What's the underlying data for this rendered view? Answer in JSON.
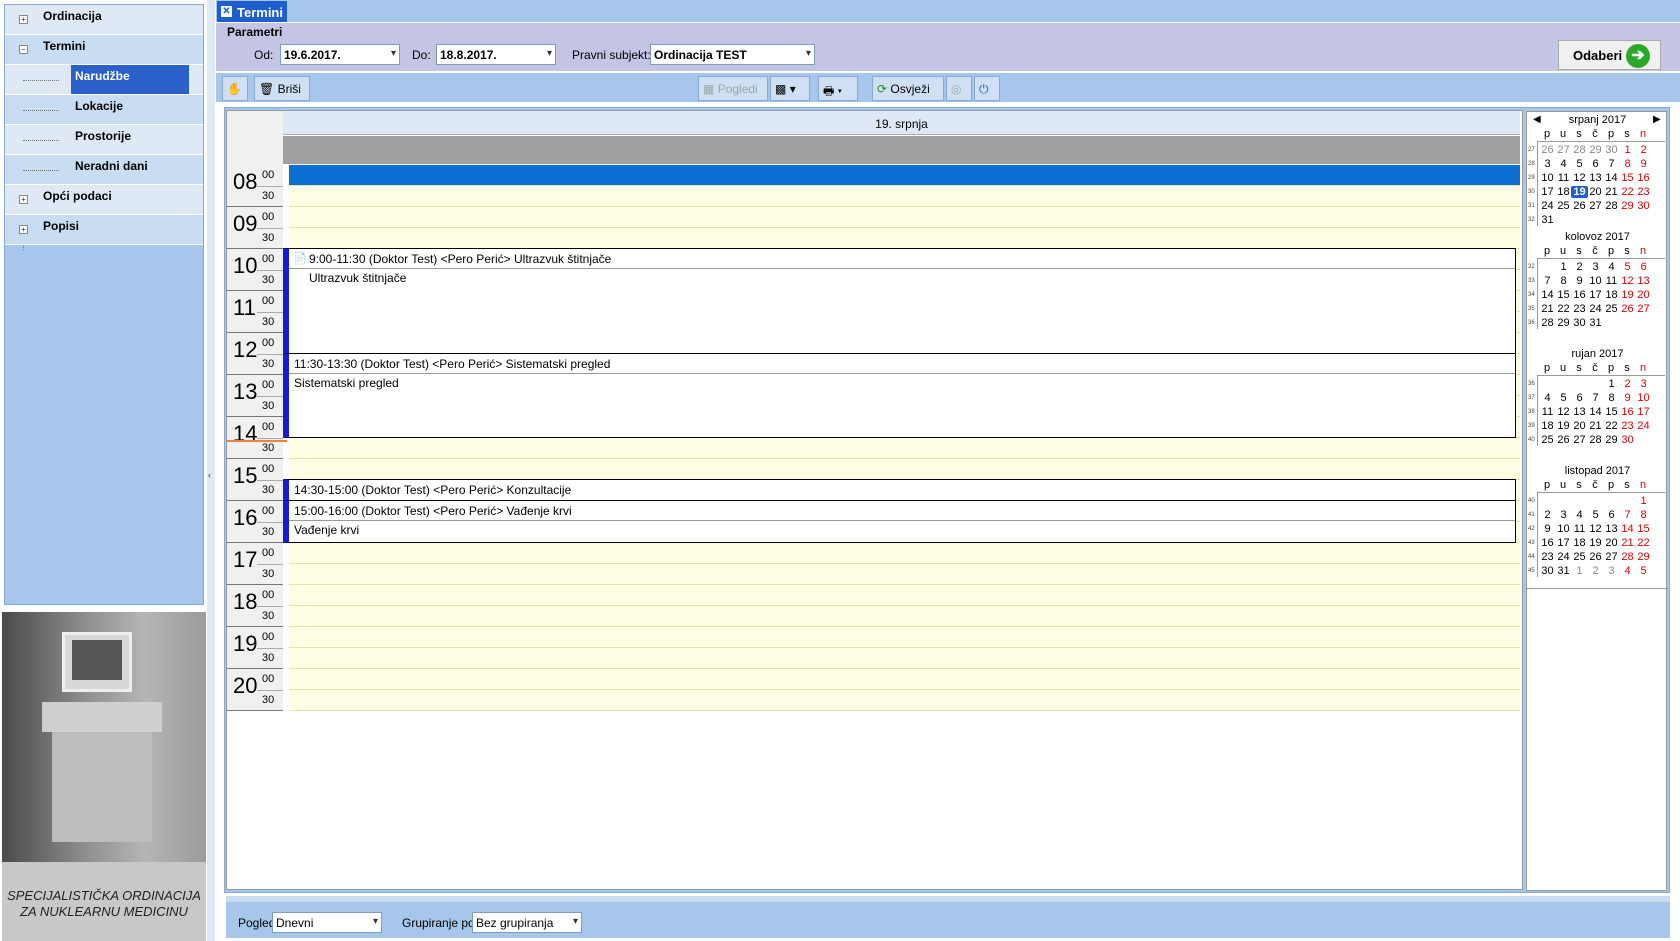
{
  "nav": {
    "items": [
      {
        "label": "Ordinacija",
        "expander": "+"
      },
      {
        "label": "Termini",
        "expander": "−"
      },
      {
        "label": "Narudžbe"
      },
      {
        "label": "Lokacije"
      },
      {
        "label": "Prostorije"
      },
      {
        "label": "Neradni dani"
      },
      {
        "label": "Opći podaci",
        "expander": "+"
      },
      {
        "label": "Popisi",
        "expander": "+"
      }
    ],
    "selected": "Narudžbe",
    "caption_line1": "SPECIJALISTIČKA ORDINACIJA",
    "caption_line2": "ZA NUKLEARNU MEDICINU"
  },
  "tab": {
    "label": "Termini"
  },
  "params": {
    "title": "Parametri",
    "od_label": "Od:",
    "od_value": "19.6.2017.",
    "do_label": "Do:",
    "do_value": "18.8.2017.",
    "subjekt_label": "Pravni subjekt:",
    "subjekt_value": "Ordinacija TEST",
    "odaberi_label": "Odaberi"
  },
  "toolbar": {
    "brisi": "Briši",
    "pogledi": "Pogledi",
    "osvjezi": "Osvježi"
  },
  "calendar": {
    "day_header": "19. srpnja",
    "hours": [
      "08",
      "09",
      "10",
      "11",
      "12",
      "13",
      "14",
      "15",
      "16",
      "17",
      "18",
      "19",
      "20"
    ],
    "m00": "00",
    "m30": "30",
    "appointments": [
      {
        "title": "9:00-11:30  (Doktor Test) <Pero Perić> Ultrazvuk štitnjače",
        "desc": "Ultrazvuk štitnjače",
        "start": 9.0,
        "end": 11.5,
        "has_icon": true
      },
      {
        "title": "11:30-13:30  (Doktor Test) <Pero Perić> Sistematski pregled",
        "desc": "Sistematski pregled",
        "start": 11.5,
        "end": 13.5,
        "has_icon": false
      },
      {
        "title": "14:30-15:00  (Doktor Test) <Pero Perić> Konzultacije",
        "desc": "",
        "start": 14.5,
        "end": 15.0,
        "has_icon": false
      },
      {
        "title": "15:00-16:00  (Doktor Test) <Pero Perić> Vađenje krvi",
        "desc": "Vađenje krvi",
        "start": 15.0,
        "end": 16.0,
        "has_icon": false
      }
    ]
  },
  "minical": {
    "weekdays": [
      "p",
      "u",
      "s",
      "č",
      "p",
      "s",
      "n"
    ],
    "months": [
      {
        "title": "srpanj 2017",
        "weeks": [
          {
            "wn": "27",
            "days": [
              [
                "26",
                "g"
              ],
              [
                "27",
                "g"
              ],
              [
                "28",
                "g"
              ],
              [
                "29",
                "g"
              ],
              [
                "30",
                "g"
              ],
              [
                "1",
                "r"
              ],
              [
                "2",
                "r"
              ]
            ]
          },
          {
            "wn": "28",
            "days": [
              [
                "3",
                ""
              ],
              [
                "4",
                ""
              ],
              [
                "5",
                ""
              ],
              [
                "6",
                ""
              ],
              [
                "7",
                ""
              ],
              [
                "8",
                "r"
              ],
              [
                "9",
                "r"
              ]
            ]
          },
          {
            "wn": "29",
            "days": [
              [
                "10",
                ""
              ],
              [
                "11",
                ""
              ],
              [
                "12",
                ""
              ],
              [
                "13",
                ""
              ],
              [
                "14",
                ""
              ],
              [
                "15",
                "r"
              ],
              [
                "16",
                "r"
              ]
            ]
          },
          {
            "wn": "30",
            "days": [
              [
                "17",
                ""
              ],
              [
                "18",
                ""
              ],
              [
                "19",
                "t"
              ],
              [
                "20",
                ""
              ],
              [
                "21",
                ""
              ],
              [
                "22",
                "r"
              ],
              [
                "23",
                "r"
              ]
            ]
          },
          {
            "wn": "31",
            "days": [
              [
                "24",
                ""
              ],
              [
                "25",
                ""
              ],
              [
                "26",
                ""
              ],
              [
                "27",
                ""
              ],
              [
                "28",
                ""
              ],
              [
                "29",
                "r"
              ],
              [
                "30",
                "r"
              ]
            ]
          },
          {
            "wn": "32",
            "days": [
              [
                "31",
                ""
              ]
            ]
          }
        ]
      },
      {
        "title": "kolovoz 2017",
        "weeks": [
          {
            "wn": "32",
            "days": [
              [
                "",
                ""
              ],
              [
                "1",
                ""
              ],
              [
                "2",
                ""
              ],
              [
                "3",
                ""
              ],
              [
                "4",
                ""
              ],
              [
                "5",
                "r"
              ],
              [
                "6",
                "r"
              ]
            ]
          },
          {
            "wn": "33",
            "days": [
              [
                "7",
                ""
              ],
              [
                "8",
                ""
              ],
              [
                "9",
                ""
              ],
              [
                "10",
                ""
              ],
              [
                "11",
                ""
              ],
              [
                "12",
                "r"
              ],
              [
                "13",
                "r"
              ]
            ]
          },
          {
            "wn": "34",
            "days": [
              [
                "14",
                ""
              ],
              [
                "15",
                ""
              ],
              [
                "16",
                ""
              ],
              [
                "17",
                ""
              ],
              [
                "18",
                ""
              ],
              [
                "19",
                "r"
              ],
              [
                "20",
                "r"
              ]
            ]
          },
          {
            "wn": "35",
            "days": [
              [
                "21",
                ""
              ],
              [
                "22",
                ""
              ],
              [
                "23",
                ""
              ],
              [
                "24",
                ""
              ],
              [
                "25",
                ""
              ],
              [
                "26",
                "r"
              ],
              [
                "27",
                "r"
              ]
            ]
          },
          {
            "wn": "36",
            "days": [
              [
                "28",
                ""
              ],
              [
                "29",
                ""
              ],
              [
                "30",
                ""
              ],
              [
                "31",
                ""
              ]
            ]
          }
        ]
      },
      {
        "title": "rujan 2017",
        "weeks": [
          {
            "wn": "36",
            "days": [
              [
                "",
                ""
              ],
              [
                "",
                ""
              ],
              [
                "",
                ""
              ],
              [
                "",
                ""
              ],
              [
                "1",
                ""
              ],
              [
                "2",
                "r"
              ],
              [
                "3",
                "r"
              ]
            ]
          },
          {
            "wn": "37",
            "days": [
              [
                "4",
                ""
              ],
              [
                "5",
                ""
              ],
              [
                "6",
                ""
              ],
              [
                "7",
                ""
              ],
              [
                "8",
                ""
              ],
              [
                "9",
                "r"
              ],
              [
                "10",
                "r"
              ]
            ]
          },
          {
            "wn": "38",
            "days": [
              [
                "11",
                ""
              ],
              [
                "12",
                ""
              ],
              [
                "13",
                ""
              ],
              [
                "14",
                ""
              ],
              [
                "15",
                ""
              ],
              [
                "16",
                "r"
              ],
              [
                "17",
                "r"
              ]
            ]
          },
          {
            "wn": "39",
            "days": [
              [
                "18",
                ""
              ],
              [
                "19",
                ""
              ],
              [
                "20",
                ""
              ],
              [
                "21",
                ""
              ],
              [
                "22",
                ""
              ],
              [
                "23",
                "r"
              ],
              [
                "24",
                "r"
              ]
            ]
          },
          {
            "wn": "40",
            "days": [
              [
                "25",
                ""
              ],
              [
                "26",
                ""
              ],
              [
                "27",
                ""
              ],
              [
                "28",
                ""
              ],
              [
                "29",
                ""
              ],
              [
                "30",
                "r"
              ]
            ]
          }
        ]
      },
      {
        "title": "listopad 2017",
        "weeks": [
          {
            "wn": "40",
            "days": [
              [
                "",
                ""
              ],
              [
                "",
                ""
              ],
              [
                "",
                ""
              ],
              [
                "",
                ""
              ],
              [
                "",
                ""
              ],
              [
                "",
                ""
              ],
              [
                "1",
                "r"
              ]
            ]
          },
          {
            "wn": "41",
            "days": [
              [
                "2",
                ""
              ],
              [
                "3",
                ""
              ],
              [
                "4",
                ""
              ],
              [
                "5",
                ""
              ],
              [
                "6",
                ""
              ],
              [
                "7",
                "r"
              ],
              [
                "8",
                "r"
              ]
            ]
          },
          {
            "wn": "42",
            "days": [
              [
                "9",
                ""
              ],
              [
                "10",
                ""
              ],
              [
                "11",
                ""
              ],
              [
                "12",
                ""
              ],
              [
                "13",
                ""
              ],
              [
                "14",
                "r"
              ],
              [
                "15",
                "r"
              ]
            ]
          },
          {
            "wn": "43",
            "days": [
              [
                "16",
                ""
              ],
              [
                "17",
                ""
              ],
              [
                "18",
                ""
              ],
              [
                "19",
                ""
              ],
              [
                "20",
                ""
              ],
              [
                "21",
                "r"
              ],
              [
                "22",
                "r"
              ]
            ]
          },
          {
            "wn": "44",
            "days": [
              [
                "23",
                ""
              ],
              [
                "24",
                ""
              ],
              [
                "25",
                ""
              ],
              [
                "26",
                ""
              ],
              [
                "27",
                ""
              ],
              [
                "28",
                "r"
              ],
              [
                "29",
                "r"
              ]
            ]
          },
          {
            "wn": "45",
            "days": [
              [
                "30",
                ""
              ],
              [
                "31",
                ""
              ],
              [
                "1",
                "g"
              ],
              [
                "2",
                "g"
              ],
              [
                "3",
                "g"
              ],
              [
                "4",
                "gr"
              ],
              [
                "5",
                "gr"
              ]
            ]
          }
        ]
      }
    ]
  },
  "bottom": {
    "pogled_label": "Pogled:",
    "pogled_value": "Dnevni",
    "grupiranje_label": "Grupiranje po:",
    "grupiranje_value": "Bez grupiranja"
  }
}
